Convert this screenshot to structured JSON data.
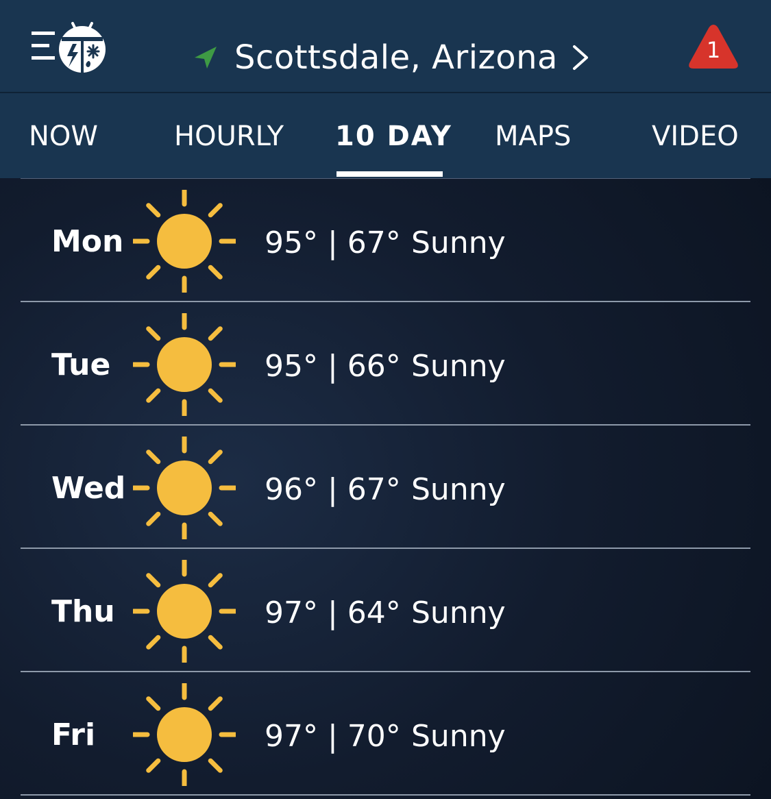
{
  "header": {
    "location": "Scottsdale,  Arizona",
    "alert_count": "1"
  },
  "tabs": [
    {
      "label": "NOW"
    },
    {
      "label": "HOURLY"
    },
    {
      "label": "10  DAY"
    },
    {
      "label": "MAPS"
    },
    {
      "label": "VIDEO"
    }
  ],
  "active_tab": "10  DAY",
  "forecast": [
    {
      "day": "Mon",
      "temps": "95° | 67°",
      "condition": "Sunny",
      "icon": "sun-icon"
    },
    {
      "day": "Tue",
      "temps": "95° | 66°",
      "condition": "Sunny",
      "icon": "sun-icon"
    },
    {
      "day": "Wed",
      "temps": "96° | 67°",
      "condition": "Sunny",
      "icon": "sun-icon"
    },
    {
      "day": "Thu",
      "temps": "97° | 64°",
      "condition": "Sunny",
      "icon": "sun-icon"
    },
    {
      "day": "Fri",
      "temps": "97° | 70°",
      "condition": "Sunny",
      "icon": "sun-icon"
    }
  ],
  "colors": {
    "header_bg": "#193550",
    "sun": "#f5bd3f",
    "alert": "#d7342b",
    "location_arrow": "#3e9a44"
  }
}
